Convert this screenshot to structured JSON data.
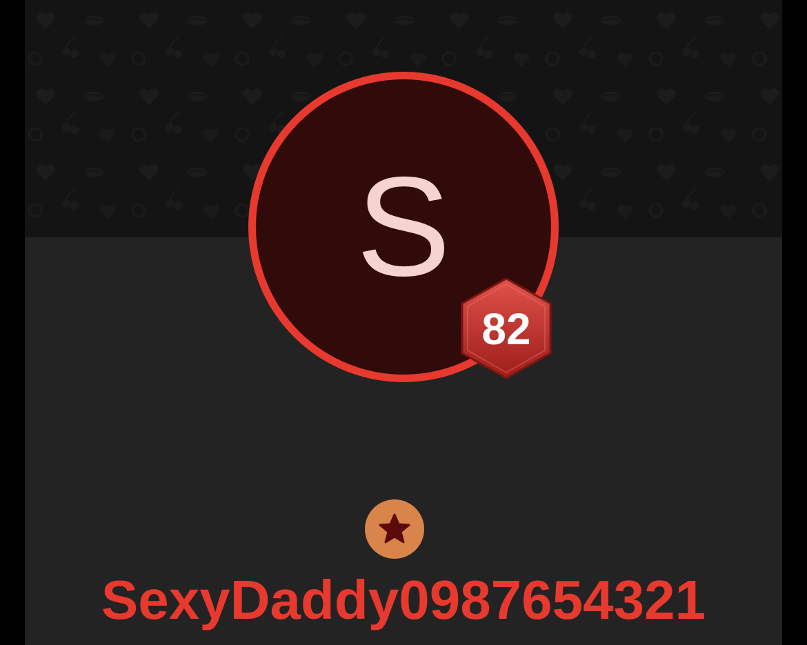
{
  "profile": {
    "avatar_initial": "S",
    "level": "82",
    "username": "SexyDaddy0987654321",
    "avatar_icon": "letter-avatar",
    "level_icon": "hexagon-badge-icon",
    "tier_icon": "star-icon",
    "banner_pattern": "hearts-lips-cherries-pattern"
  },
  "colors": {
    "accent": "#e8392f",
    "avatar_fill": "#310b0a",
    "avatar_letter": "#f7d3cf",
    "tier_badge": "#d9844a",
    "tier_star": "#5c0a0a",
    "panel_bg": "#232323",
    "banner_bg": "#141414"
  }
}
